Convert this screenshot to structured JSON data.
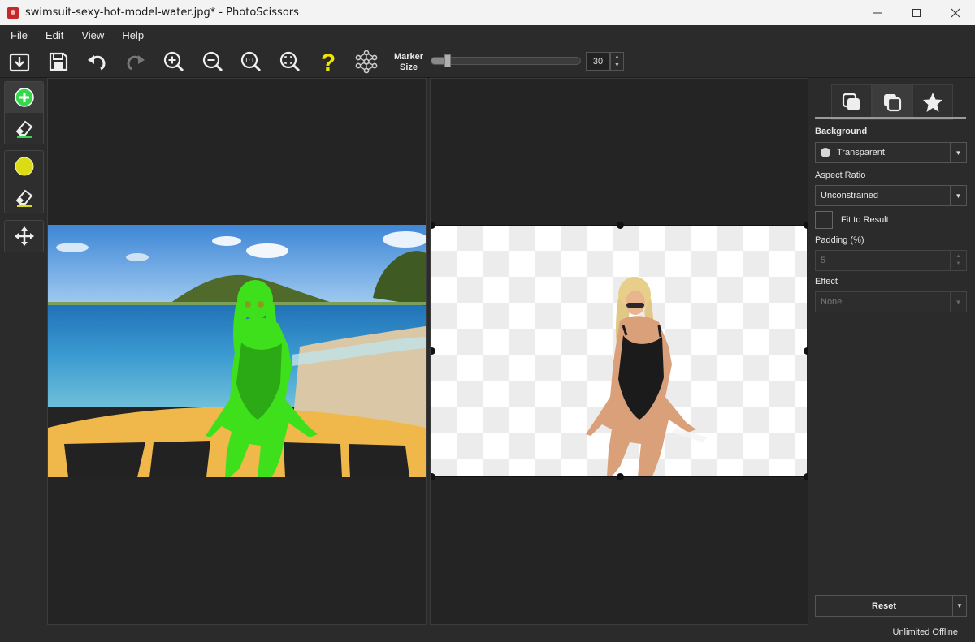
{
  "window": {
    "title": "swimsuit-sexy-hot-model-water.jpg* - PhotoScissors",
    "minimize": "—",
    "maximize": "☐",
    "close": "✕"
  },
  "menu": [
    "File",
    "Edit",
    "View",
    "Help"
  ],
  "toolbar": {
    "marker_label_line1": "Marker",
    "marker_label_line2": "Size",
    "marker_size": "30",
    "marker_fraction": 0.1,
    "help_glyph": "?",
    "zoom_actual_glyph": "1:1"
  },
  "tools": [
    "add-marker",
    "erase-marker",
    "background-marker",
    "erase-background-marker",
    "move"
  ],
  "colors": {
    "foreground_marker": "#35d84a",
    "background_marker": "#dcdc14",
    "help_yellow": "#f2e600",
    "overlay_green": "#3ee01c"
  },
  "right_panel": {
    "tabs": [
      "background-tab",
      "foreground-tab",
      "effects-tab"
    ],
    "background_label": "Background",
    "background_value": "Transparent",
    "aspect_ratio_label": "Aspect Ratio",
    "aspect_ratio_value": "Unconstrained",
    "fit_to_result_label": "Fit to Result",
    "padding_label": "Padding (%)",
    "padding_value": "5",
    "effect_label": "Effect",
    "effect_value": "None",
    "reset_label": "Reset"
  },
  "status": "Unlimited Offline"
}
